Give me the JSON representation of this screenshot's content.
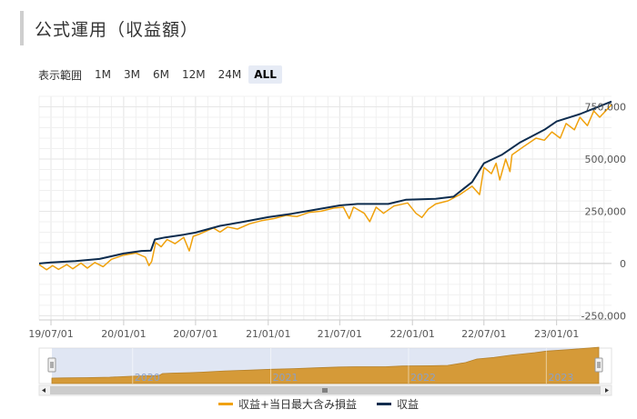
{
  "header": {
    "title": "公式運用（収益額）"
  },
  "range_selector": {
    "label": "表示範囲",
    "buttons": [
      {
        "label": "1M",
        "active": false
      },
      {
        "label": "3M",
        "active": false
      },
      {
        "label": "6M",
        "active": false
      },
      {
        "label": "12M",
        "active": false
      },
      {
        "label": "24M",
        "active": false
      },
      {
        "label": "ALL",
        "active": true
      }
    ]
  },
  "chart_data": {
    "type": "line",
    "x_ticks": [
      "19/07/01",
      "20/01/01",
      "20/07/01",
      "21/01/01",
      "21/07/01",
      "22/01/01",
      "22/07/01",
      "23/01/01"
    ],
    "y_ticks": [
      "750,000",
      "500,000",
      "250,000",
      "0",
      "-250,000"
    ],
    "y_tick_values": [
      750000,
      500000,
      250000,
      0,
      -250000
    ],
    "ylim": [
      -270000,
      800000
    ],
    "x_range": [
      "2019-06-01",
      "2023-05-20"
    ],
    "series": [
      {
        "name": "収益",
        "color": "#0d2c4e",
        "points": [
          [
            "2019-06-01",
            0
          ],
          [
            "2019-07-01",
            5000
          ],
          [
            "2019-09-01",
            12000
          ],
          [
            "2019-11-01",
            22000
          ],
          [
            "2020-01-01",
            48000
          ],
          [
            "2020-02-15",
            60000
          ],
          [
            "2020-03-10",
            62000
          ],
          [
            "2020-03-20",
            115000
          ],
          [
            "2020-04-15",
            125000
          ],
          [
            "2020-06-01",
            138000
          ],
          [
            "2020-07-01",
            148000
          ],
          [
            "2020-09-01",
            180000
          ],
          [
            "2020-11-01",
            200000
          ],
          [
            "2021-01-01",
            222000
          ],
          [
            "2021-03-01",
            238000
          ],
          [
            "2021-05-01",
            258000
          ],
          [
            "2021-07-01",
            278000
          ],
          [
            "2021-08-15",
            285000
          ],
          [
            "2021-11-01",
            285000
          ],
          [
            "2021-12-15",
            305000
          ],
          [
            "2022-03-01",
            310000
          ],
          [
            "2022-04-15",
            320000
          ],
          [
            "2022-06-01",
            390000
          ],
          [
            "2022-07-01",
            480000
          ],
          [
            "2022-08-15",
            520000
          ],
          [
            "2022-10-01",
            580000
          ],
          [
            "2022-12-01",
            640000
          ],
          [
            "2023-01-01",
            680000
          ],
          [
            "2023-03-01",
            715000
          ],
          [
            "2023-05-20",
            775000
          ]
        ]
      },
      {
        "name": "収益+当日最大含み損益",
        "color": "#f0a10c",
        "points": [
          [
            "2019-06-01",
            -5000
          ],
          [
            "2019-06-20",
            -30000
          ],
          [
            "2019-07-05",
            -10000
          ],
          [
            "2019-07-20",
            -28000
          ],
          [
            "2019-08-10",
            -5000
          ],
          [
            "2019-08-25",
            -25000
          ],
          [
            "2019-09-15",
            2000
          ],
          [
            "2019-10-01",
            -22000
          ],
          [
            "2019-10-20",
            5000
          ],
          [
            "2019-11-10",
            -15000
          ],
          [
            "2019-12-01",
            20000
          ],
          [
            "2020-01-01",
            40000
          ],
          [
            "2020-02-01",
            50000
          ],
          [
            "2020-02-25",
            30000
          ],
          [
            "2020-03-05",
            -10000
          ],
          [
            "2020-03-12",
            10000
          ],
          [
            "2020-03-22",
            100000
          ],
          [
            "2020-04-05",
            80000
          ],
          [
            "2020-04-20",
            115000
          ],
          [
            "2020-05-10",
            95000
          ],
          [
            "2020-06-01",
            125000
          ],
          [
            "2020-06-15",
            60000
          ],
          [
            "2020-06-25",
            130000
          ],
          [
            "2020-07-10",
            140000
          ],
          [
            "2020-08-15",
            170000
          ],
          [
            "2020-09-01",
            150000
          ],
          [
            "2020-09-20",
            175000
          ],
          [
            "2020-10-15",
            165000
          ],
          [
            "2020-11-15",
            190000
          ],
          [
            "2020-12-15",
            205000
          ],
          [
            "2021-01-15",
            215000
          ],
          [
            "2021-02-15",
            230000
          ],
          [
            "2021-03-15",
            225000
          ],
          [
            "2021-04-15",
            245000
          ],
          [
            "2021-05-15",
            250000
          ],
          [
            "2021-06-15",
            265000
          ],
          [
            "2021-07-10",
            270000
          ],
          [
            "2021-07-25",
            215000
          ],
          [
            "2021-08-05",
            270000
          ],
          [
            "2021-09-01",
            240000
          ],
          [
            "2021-09-15",
            200000
          ],
          [
            "2021-10-01",
            270000
          ],
          [
            "2021-10-20",
            240000
          ],
          [
            "2021-11-15",
            275000
          ],
          [
            "2021-12-20",
            290000
          ],
          [
            "2022-01-10",
            240000
          ],
          [
            "2022-01-25",
            220000
          ],
          [
            "2022-02-10",
            260000
          ],
          [
            "2022-03-01",
            285000
          ],
          [
            "2022-04-01",
            300000
          ],
          [
            "2022-05-01",
            330000
          ],
          [
            "2022-06-01",
            370000
          ],
          [
            "2022-06-20",
            330000
          ],
          [
            "2022-07-01",
            460000
          ],
          [
            "2022-07-20",
            430000
          ],
          [
            "2022-08-01",
            480000
          ],
          [
            "2022-08-10",
            400000
          ],
          [
            "2022-08-25",
            500000
          ],
          [
            "2022-09-05",
            440000
          ],
          [
            "2022-09-10",
            520000
          ],
          [
            "2022-10-10",
            560000
          ],
          [
            "2022-11-10",
            600000
          ],
          [
            "2022-12-01",
            590000
          ],
          [
            "2022-12-20",
            630000
          ],
          [
            "2023-01-10",
            600000
          ],
          [
            "2023-01-25",
            670000
          ],
          [
            "2023-02-15",
            640000
          ],
          [
            "2023-03-01",
            700000
          ],
          [
            "2023-03-20",
            660000
          ],
          [
            "2023-04-05",
            730000
          ],
          [
            "2023-04-20",
            700000
          ],
          [
            "2023-05-20",
            760000
          ]
        ]
      }
    ],
    "navigator": {
      "x_ticks": [
        "2020",
        "2021",
        "2022",
        "2023"
      ]
    }
  },
  "colors": {
    "grid": "#e6e6e6",
    "zero_line": "#cccccc",
    "navigator_fill": "#d59a38",
    "navigator_mask": "#ccd6eb"
  }
}
